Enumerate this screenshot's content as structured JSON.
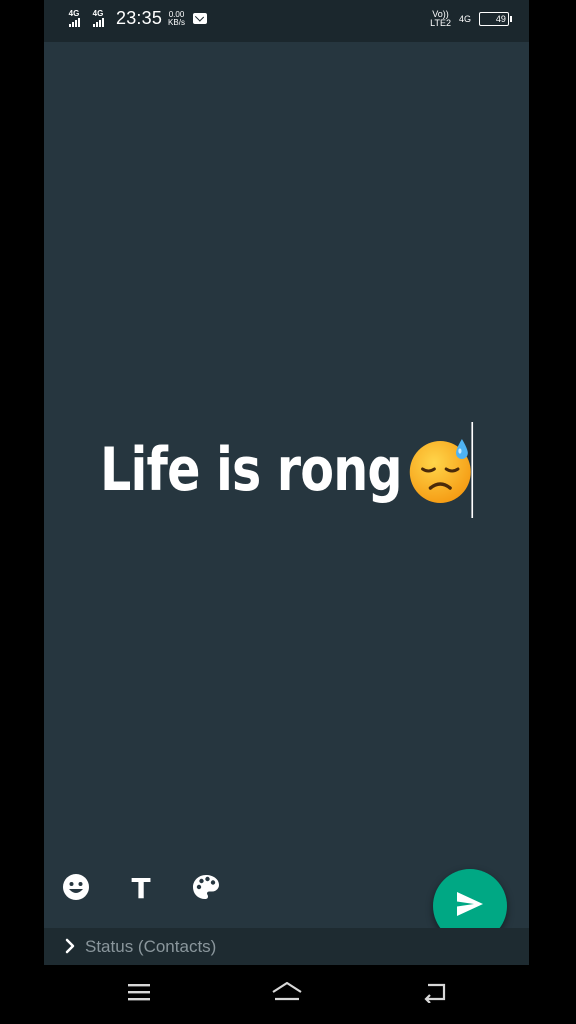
{
  "status_bar": {
    "sim1_network": "4G",
    "sim2_network": "4G",
    "time": "23:35",
    "speed_value": "0.00",
    "speed_unit": "KB/s",
    "volte_top": "Vo))",
    "volte_bottom": "LTE2",
    "data_network": "4G",
    "battery_level": "49",
    "battery_fraction": 0.49
  },
  "composer": {
    "status_text": "Life is rong",
    "emoji_icon": "downcast-face-with-sweat-icon"
  },
  "toolbar": {
    "emoji_icon": "smiley-icon",
    "font_icon": "text-font-icon",
    "font_label": "T",
    "color_icon": "palette-icon"
  },
  "footer": {
    "audience_label": "Status (Contacts)"
  },
  "colors": {
    "background": "#26363f",
    "accent": "#00a884",
    "text": "#ffffff"
  }
}
